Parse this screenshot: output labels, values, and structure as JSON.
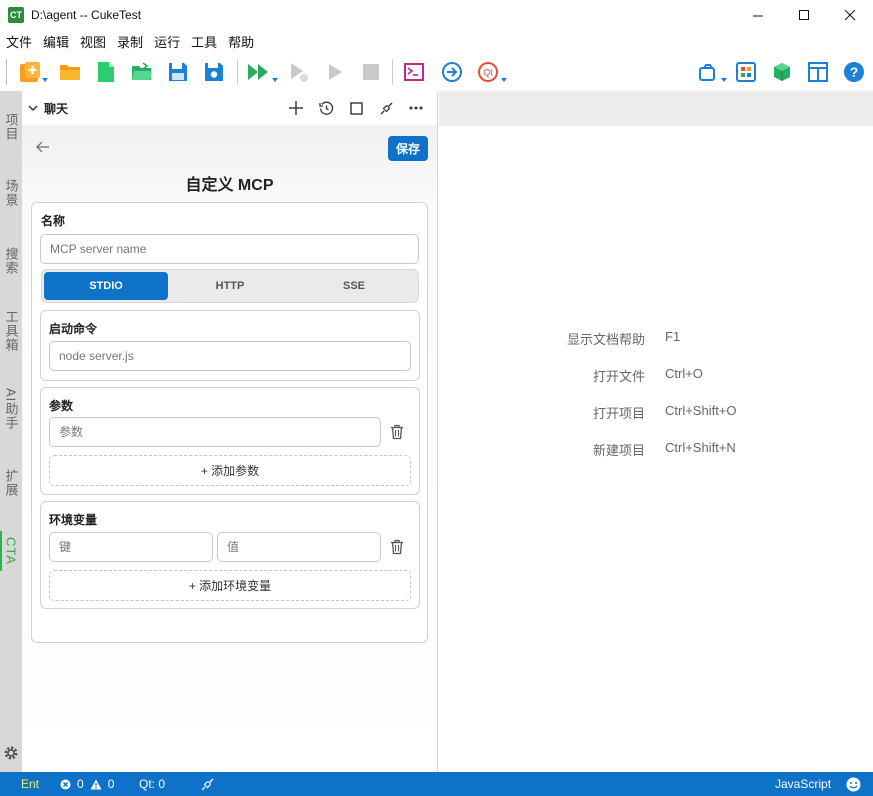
{
  "window": {
    "title": "D:\\agent -- CukeTest",
    "logo_text": "CT"
  },
  "menu": [
    "文件",
    "编辑",
    "视图",
    "录制",
    "运行",
    "工具",
    "帮助"
  ],
  "activity_tabs": [
    {
      "label": "项目",
      "active": false
    },
    {
      "label": "场景",
      "active": false
    },
    {
      "label": "搜索",
      "active": false
    },
    {
      "label": "工具箱",
      "active": false
    },
    {
      "label": "AI助手",
      "active": false
    },
    {
      "label": "扩展",
      "active": false
    },
    {
      "label": "CTA",
      "active": true
    }
  ],
  "panel": {
    "title": "聊天"
  },
  "mcp": {
    "save_label": "保存",
    "title": "自定义 MCP",
    "name_label": "名称",
    "name_placeholder": "MCP server name",
    "tabs": [
      "STDIO",
      "HTTP",
      "SSE"
    ],
    "active_tab": "STDIO",
    "command": {
      "label": "启动命令",
      "placeholder": "node server.js"
    },
    "args": {
      "label": "参数",
      "placeholder": "参数",
      "add_label": "+ 添加参数"
    },
    "env": {
      "label": "环境变量",
      "key_placeholder": "键",
      "value_placeholder": "值",
      "add_label": "+ 添加环境变量"
    }
  },
  "shortcuts": [
    {
      "label": "显示文档帮助",
      "key": "F1"
    },
    {
      "label": "打开文件",
      "key": "Ctrl+O"
    },
    {
      "label": "打开项目",
      "key": "Ctrl+Shift+O"
    },
    {
      "label": "新建项目",
      "key": "Ctrl+Shift+N"
    }
  ],
  "status": {
    "mode": "Ent",
    "errors": "0",
    "warnings": "0",
    "qt": "Qt: 0",
    "language": "JavaScript"
  },
  "colors": {
    "accent": "#0e72c9",
    "cta_green": "#2bb34a"
  }
}
